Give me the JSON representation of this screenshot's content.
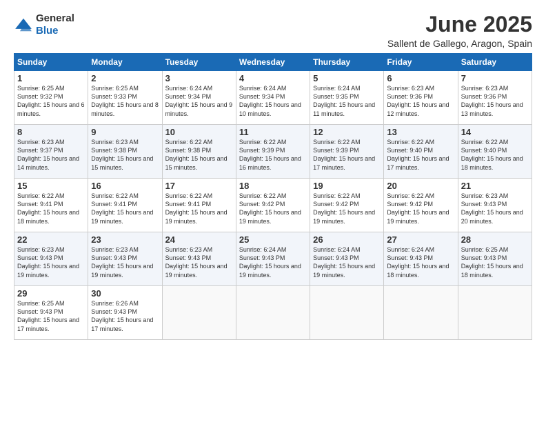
{
  "logo": {
    "general": "General",
    "blue": "Blue"
  },
  "title": "June 2025",
  "subtitle": "Sallent de Gallego, Aragon, Spain",
  "days_header": [
    "Sunday",
    "Monday",
    "Tuesday",
    "Wednesday",
    "Thursday",
    "Friday",
    "Saturday"
  ],
  "weeks": [
    [
      {
        "day": "1",
        "rise": "Sunrise: 6:25 AM",
        "set": "Sunset: 9:32 PM",
        "day_light": "Daylight: 15 hours and 6 minutes."
      },
      {
        "day": "2",
        "rise": "Sunrise: 6:25 AM",
        "set": "Sunset: 9:33 PM",
        "day_light": "Daylight: 15 hours and 8 minutes."
      },
      {
        "day": "3",
        "rise": "Sunrise: 6:24 AM",
        "set": "Sunset: 9:34 PM",
        "day_light": "Daylight: 15 hours and 9 minutes."
      },
      {
        "day": "4",
        "rise": "Sunrise: 6:24 AM",
        "set": "Sunset: 9:34 PM",
        "day_light": "Daylight: 15 hours and 10 minutes."
      },
      {
        "day": "5",
        "rise": "Sunrise: 6:24 AM",
        "set": "Sunset: 9:35 PM",
        "day_light": "Daylight: 15 hours and 11 minutes."
      },
      {
        "day": "6",
        "rise": "Sunrise: 6:23 AM",
        "set": "Sunset: 9:36 PM",
        "day_light": "Daylight: 15 hours and 12 minutes."
      },
      {
        "day": "7",
        "rise": "Sunrise: 6:23 AM",
        "set": "Sunset: 9:36 PM",
        "day_light": "Daylight: 15 hours and 13 minutes."
      }
    ],
    [
      {
        "day": "8",
        "rise": "Sunrise: 6:23 AM",
        "set": "Sunset: 9:37 PM",
        "day_light": "Daylight: 15 hours and 14 minutes."
      },
      {
        "day": "9",
        "rise": "Sunrise: 6:23 AM",
        "set": "Sunset: 9:38 PM",
        "day_light": "Daylight: 15 hours and 15 minutes."
      },
      {
        "day": "10",
        "rise": "Sunrise: 6:22 AM",
        "set": "Sunset: 9:38 PM",
        "day_light": "Daylight: 15 hours and 15 minutes."
      },
      {
        "day": "11",
        "rise": "Sunrise: 6:22 AM",
        "set": "Sunset: 9:39 PM",
        "day_light": "Daylight: 15 hours and 16 minutes."
      },
      {
        "day": "12",
        "rise": "Sunrise: 6:22 AM",
        "set": "Sunset: 9:39 PM",
        "day_light": "Daylight: 15 hours and 17 minutes."
      },
      {
        "day": "13",
        "rise": "Sunrise: 6:22 AM",
        "set": "Sunset: 9:40 PM",
        "day_light": "Daylight: 15 hours and 17 minutes."
      },
      {
        "day": "14",
        "rise": "Sunrise: 6:22 AM",
        "set": "Sunset: 9:40 PM",
        "day_light": "Daylight: 15 hours and 18 minutes."
      }
    ],
    [
      {
        "day": "15",
        "rise": "Sunrise: 6:22 AM",
        "set": "Sunset: 9:41 PM",
        "day_light": "Daylight: 15 hours and 18 minutes."
      },
      {
        "day": "16",
        "rise": "Sunrise: 6:22 AM",
        "set": "Sunset: 9:41 PM",
        "day_light": "Daylight: 15 hours and 19 minutes."
      },
      {
        "day": "17",
        "rise": "Sunrise: 6:22 AM",
        "set": "Sunset: 9:41 PM",
        "day_light": "Daylight: 15 hours and 19 minutes."
      },
      {
        "day": "18",
        "rise": "Sunrise: 6:22 AM",
        "set": "Sunset: 9:42 PM",
        "day_light": "Daylight: 15 hours and 19 minutes."
      },
      {
        "day": "19",
        "rise": "Sunrise: 6:22 AM",
        "set": "Sunset: 9:42 PM",
        "day_light": "Daylight: 15 hours and 19 minutes."
      },
      {
        "day": "20",
        "rise": "Sunrise: 6:22 AM",
        "set": "Sunset: 9:42 PM",
        "day_light": "Daylight: 15 hours and 19 minutes."
      },
      {
        "day": "21",
        "rise": "Sunrise: 6:23 AM",
        "set": "Sunset: 9:43 PM",
        "day_light": "Daylight: 15 hours and 20 minutes."
      }
    ],
    [
      {
        "day": "22",
        "rise": "Sunrise: 6:23 AM",
        "set": "Sunset: 9:43 PM",
        "day_light": "Daylight: 15 hours and 19 minutes."
      },
      {
        "day": "23",
        "rise": "Sunrise: 6:23 AM",
        "set": "Sunset: 9:43 PM",
        "day_light": "Daylight: 15 hours and 19 minutes."
      },
      {
        "day": "24",
        "rise": "Sunrise: 6:23 AM",
        "set": "Sunset: 9:43 PM",
        "day_light": "Daylight: 15 hours and 19 minutes."
      },
      {
        "day": "25",
        "rise": "Sunrise: 6:24 AM",
        "set": "Sunset: 9:43 PM",
        "day_light": "Daylight: 15 hours and 19 minutes."
      },
      {
        "day": "26",
        "rise": "Sunrise: 6:24 AM",
        "set": "Sunset: 9:43 PM",
        "day_light": "Daylight: 15 hours and 19 minutes."
      },
      {
        "day": "27",
        "rise": "Sunrise: 6:24 AM",
        "set": "Sunset: 9:43 PM",
        "day_light": "Daylight: 15 hours and 18 minutes."
      },
      {
        "day": "28",
        "rise": "Sunrise: 6:25 AM",
        "set": "Sunset: 9:43 PM",
        "day_light": "Daylight: 15 hours and 18 minutes."
      }
    ],
    [
      {
        "day": "29",
        "rise": "Sunrise: 6:25 AM",
        "set": "Sunset: 9:43 PM",
        "day_light": "Daylight: 15 hours and 17 minutes."
      },
      {
        "day": "30",
        "rise": "Sunrise: 6:26 AM",
        "set": "Sunset: 9:43 PM",
        "day_light": "Daylight: 15 hours and 17 minutes."
      },
      null,
      null,
      null,
      null,
      null
    ]
  ]
}
